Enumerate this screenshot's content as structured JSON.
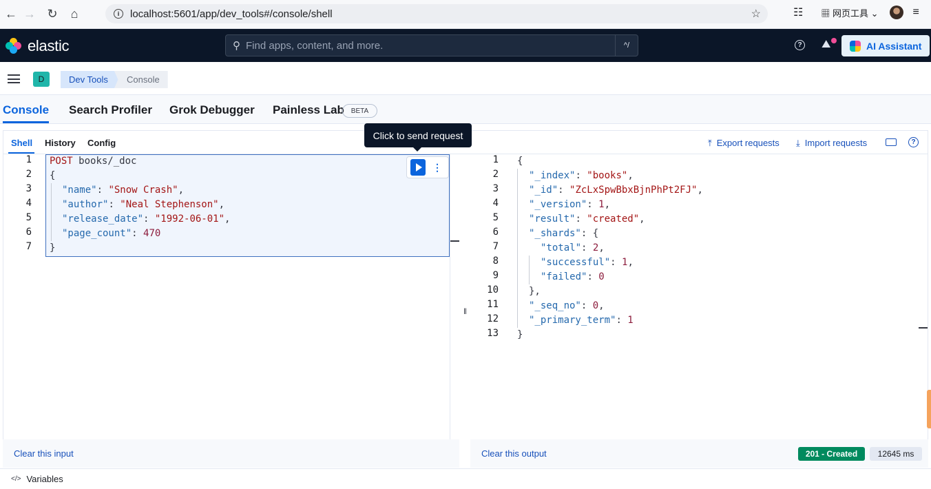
{
  "browser": {
    "url": "localhost:5601/app/dev_tools#/console/shell",
    "toolbar_label": "网页工具"
  },
  "header": {
    "logo_text": "elastic",
    "search_placeholder": "Find apps, content, and more.",
    "search_shortcut": "^/",
    "ai_label": "AI Assistant"
  },
  "breadcrumb": {
    "space_initial": "D",
    "items": [
      "Dev Tools",
      "Console"
    ]
  },
  "tabs": [
    "Console",
    "Search Profiler",
    "Grok Debugger",
    "Painless Lab"
  ],
  "beta_label": "BETA",
  "subtabs": [
    "Shell",
    "History",
    "Config"
  ],
  "actions": {
    "export": "Export requests",
    "import": "Import requests"
  },
  "tooltip": "Click to send request",
  "request": {
    "line_numbers": [
      "1",
      "2",
      "3",
      "4",
      "5",
      "6",
      "7"
    ],
    "method": "POST",
    "path": "books/_doc",
    "fields": [
      {
        "key": "\"name\"",
        "value": "\"Snow Crash\""
      },
      {
        "key": "\"author\"",
        "value": "\"Neal Stephenson\""
      },
      {
        "key": "\"release_date\"",
        "value": "\"1992-06-01\""
      },
      {
        "key": "\"page_count\"",
        "value": "470"
      }
    ]
  },
  "response": {
    "line_numbers": [
      "1",
      "2",
      "3",
      "4",
      "5",
      "6",
      "7",
      "8",
      "9",
      "10",
      "11",
      "12",
      "13"
    ],
    "index_key": "\"_index\"",
    "index_val": "\"books\"",
    "id_key": "\"_id\"",
    "id_val": "\"ZcLxSpwBbxBjnPhPt2FJ\"",
    "version_key": "\"_version\"",
    "version_val": "1",
    "result_key": "\"result\"",
    "result_val": "\"created\"",
    "shards_key": "\"_shards\"",
    "total_key": "\"total\"",
    "total_val": "2",
    "successful_key": "\"successful\"",
    "successful_val": "1",
    "failed_key": "\"failed\"",
    "failed_val": "0",
    "seq_key": "\"_seq_no\"",
    "seq_val": "0",
    "term_key": "\"_primary_term\"",
    "term_val": "1"
  },
  "footer": {
    "clear_input": "Clear this input",
    "clear_output": "Clear this output",
    "status": "201 - Created",
    "time": "12645 ms"
  },
  "variables_label": "Variables",
  "colors": {
    "accent": "#0b64dd",
    "header_bg": "#0b1628",
    "status_green": "#008a5e"
  }
}
